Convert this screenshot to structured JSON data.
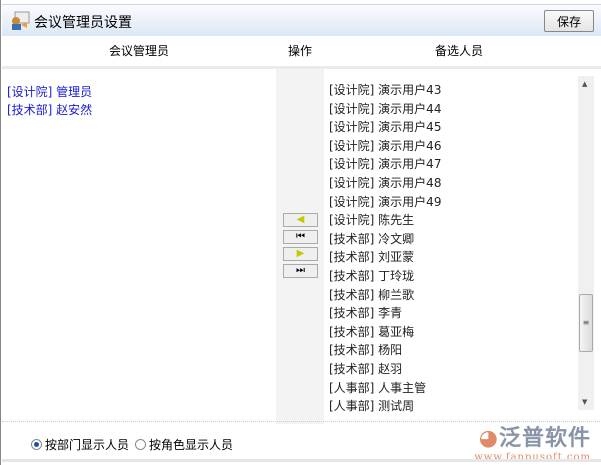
{
  "title": "会议管理员设置",
  "save_label": "保存",
  "headers": {
    "admins": "会议管理员",
    "ops": "操作",
    "candidates": "备选人员"
  },
  "admins": [
    "[设计院] 管理员",
    "[技术部] 赵安然"
  ],
  "candidates": [
    "[设计院] 演示用户43",
    "[设计院] 演示用户44",
    "[设计院] 演示用户45",
    "[设计院] 演示用户46",
    "[设计院] 演示用户47",
    "[设计院] 演示用户48",
    "[设计院] 演示用户49",
    "[设计院] 陈先生",
    "[技术部] 冷文卿",
    "[技术部] 刘亚蒙",
    "[技术部] 丁玲珑",
    "[技术部] 柳兰歌",
    "[技术部] 李青",
    "[技术部] 葛亚梅",
    "[技术部] 杨阳",
    "[技术部] 赵羽",
    "[人事部] 人事主管",
    "[人事部] 测试周"
  ],
  "radio": {
    "by_dept": "按部门显示人员",
    "by_role": "按角色显示人员",
    "selected": "by_dept"
  },
  "logo": {
    "name": "泛普软件",
    "url": "www.fanpusoft.com"
  }
}
